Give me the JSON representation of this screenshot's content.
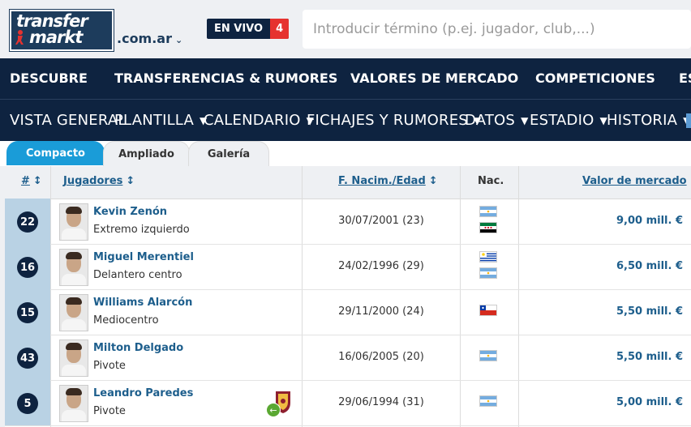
{
  "header": {
    "logo_line1": "transfer",
    "logo_line2": "markt",
    "domain": ".com.ar",
    "domain_caret": "⌄",
    "live_label": "EN VIVO",
    "live_count": "4",
    "search_placeholder": "Introducir término (p.ej. jugador, club,...)"
  },
  "main_nav": [
    "DESCUBRE",
    "TRANSFERENCIAS & RUMORES",
    "VALORES DE MERCADO",
    "COMPETICIONES",
    "ES"
  ],
  "sub_nav": [
    {
      "label": "VISTA GENERAL",
      "has_menu": false
    },
    {
      "label": "PLANTILLA",
      "has_menu": true
    },
    {
      "label": "CALENDARIO",
      "has_menu": true
    },
    {
      "label": "FICHAJES Y RUMORES",
      "has_menu": true
    },
    {
      "label": "DATOS",
      "has_menu": true
    },
    {
      "label": "ESTADIO",
      "has_menu": true
    },
    {
      "label": "HISTORIA",
      "has_menu": true
    }
  ],
  "sub_nav_caret": "▼",
  "tabs": [
    {
      "label": "Compacto",
      "active": true
    },
    {
      "label": "Ampliado",
      "active": false
    },
    {
      "label": "Galería",
      "active": false
    }
  ],
  "table": {
    "headers": {
      "number": "#",
      "players": "Jugadores",
      "dob_age": "F. Nacim./Edad",
      "nationality": "Nac.",
      "market_value": "Valor de mercado"
    },
    "sort_glyph": "↕",
    "sort_desc_glyph": "↓",
    "rows": [
      {
        "number": "22",
        "name": "Kevin Zenón",
        "position": "Extremo izquierdo",
        "dob_age": "30/07/2001 (23)",
        "flags": [
          "argentina-flag",
          "syria-flag"
        ],
        "value": "9,00 mill. €",
        "loan_from_club": false
      },
      {
        "number": "16",
        "name": "Miguel Merentiel",
        "position": "Delantero centro",
        "dob_age": "24/02/1996 (29)",
        "flags": [
          "uruguay-flag",
          "argentina-flag"
        ],
        "value": "6,50 mill. €",
        "loan_from_club": false
      },
      {
        "number": "15",
        "name": "Williams Alarcón",
        "position": "Mediocentro",
        "dob_age": "29/11/2000 (24)",
        "flags": [
          "chile-flag"
        ],
        "value": "5,50 mill. €",
        "loan_from_club": false
      },
      {
        "number": "43",
        "name": "Milton Delgado",
        "position": "Pivote",
        "dob_age": "16/06/2005 (20)",
        "flags": [
          "argentina-flag"
        ],
        "value": "5,50 mill. €",
        "loan_from_club": false
      },
      {
        "number": "5",
        "name": "Leandro Paredes",
        "position": "Pivote",
        "dob_age": "29/06/1994 (31)",
        "flags": [
          "argentina-flag"
        ],
        "value": "5,00 mill. €",
        "loan_from_club": true
      }
    ]
  },
  "colors": {
    "navy": "#0e2340",
    "accent_blue": "#1a9cd8",
    "link_blue": "#1d5e8c",
    "live_red": "#e6322f",
    "number_cell": "#b9d2e4"
  }
}
